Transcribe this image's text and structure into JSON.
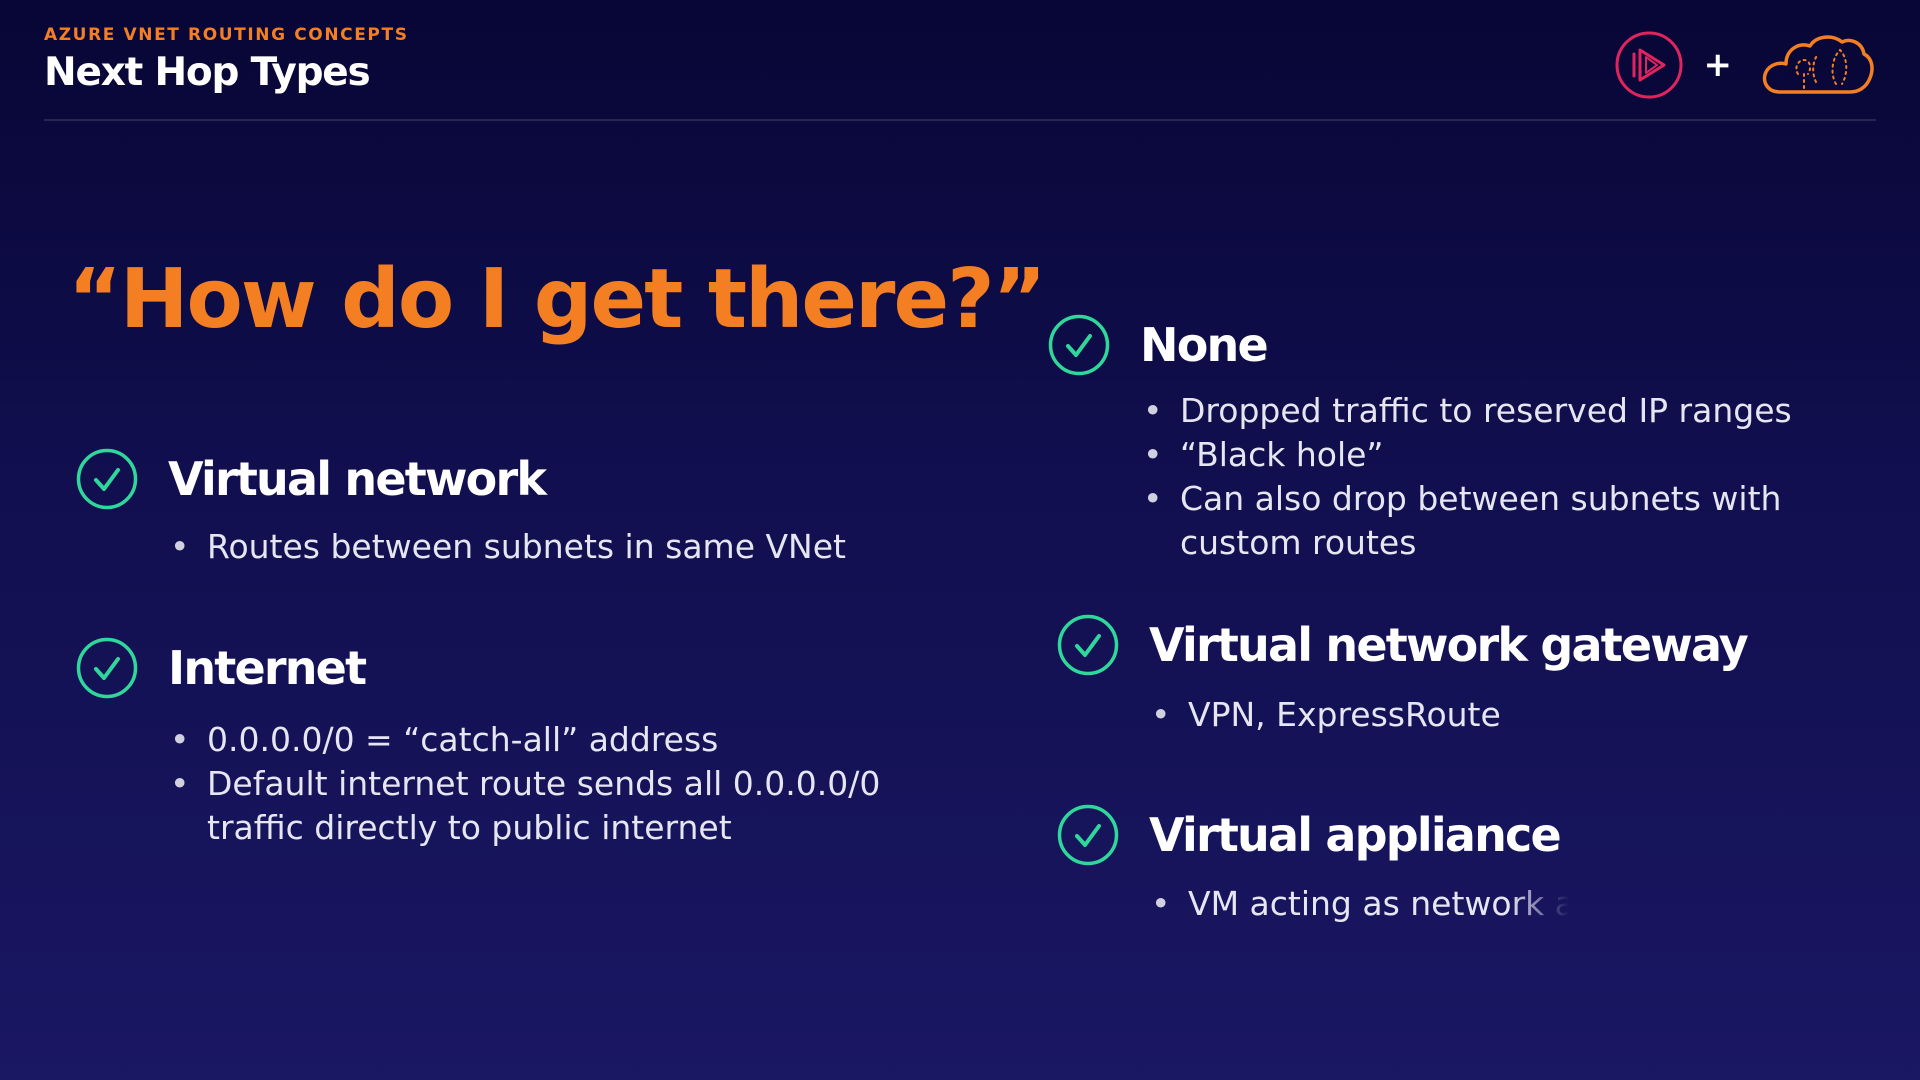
{
  "header": {
    "eyebrow": "AZURE VNET ROUTING CONCEPTS",
    "title": "Next Hop Types",
    "plus": "+"
  },
  "headline": "“How do I get there?”",
  "items": [
    {
      "title": "Virtual network",
      "bullets": [
        "Routes between subnets in same VNet"
      ]
    },
    {
      "title": "Internet",
      "bullets": [
        "0.0.0.0/0 = “catch-all” address",
        "Default internet route sends all 0.0.0.0/0",
        "traffic directly to public internet"
      ]
    },
    {
      "title": "None",
      "bullets": [
        "Dropped traffic to reserved IP ranges",
        "“Black hole”",
        "Can also drop between subnets with",
        "custom routes"
      ]
    },
    {
      "title": "Virtual network gateway",
      "bullets": [
        "VPN, ExpressRoute"
      ]
    },
    {
      "title": "Virtual appliance",
      "bullets": [
        "VM acting as network ap"
      ]
    }
  ],
  "colors": {
    "accent": "#f47e22",
    "check": "#2fd89a",
    "play": "#e0245e",
    "background": "#110f4f"
  },
  "icons": {
    "check": "check-circle-icon",
    "brand_left": "play-circle-logo-icon",
    "brand_right": "cloud-logo-icon"
  }
}
